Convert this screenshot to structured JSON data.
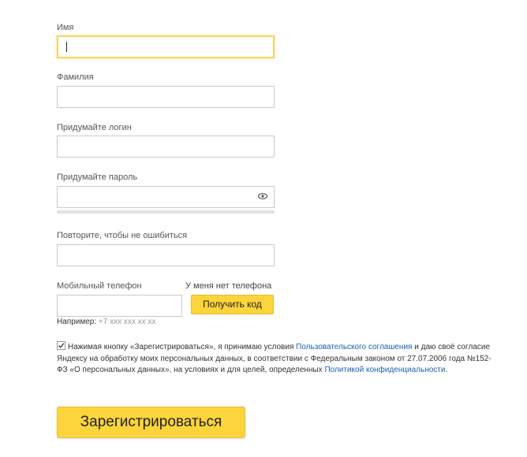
{
  "fields": {
    "first_name": {
      "label": "Имя",
      "value": ""
    },
    "last_name": {
      "label": "Фамилия",
      "value": ""
    },
    "login": {
      "label": "Придумайте логин",
      "value": ""
    },
    "password": {
      "label": "Придумайте пароль",
      "value": "",
      "icon": "eye-icon"
    },
    "password_repeat": {
      "label": "Повторите, чтобы не ошибиться",
      "value": ""
    },
    "phone": {
      "label": "Мобильный телефон",
      "value": "",
      "no_phone_link": "У меня нет телефона",
      "get_code_button": "Получить код",
      "hint_prefix": "Например:",
      "hint_sample": "+7 xxx xxx xx xx"
    }
  },
  "agreement": {
    "checked": true,
    "text_1": "Нажимая кнопку «Зарегистрироваться», я принимаю условия ",
    "link_terms": "Пользовательского соглашения",
    "text_2": " и даю своё согласие Яндексу на обработку моих персональных данных, в соответствии с Федеральным законом от 27.07.2006 года №152-ФЗ «О персональных данных», на условиях и для целей, определенных ",
    "link_privacy": "Политикой конфиденциальности",
    "text_3": "."
  },
  "submit_button": "Зарегистрироваться",
  "colors": {
    "accent": "#fcd43b",
    "focus_border": "#f5d563",
    "link": "#1a5fb4"
  }
}
